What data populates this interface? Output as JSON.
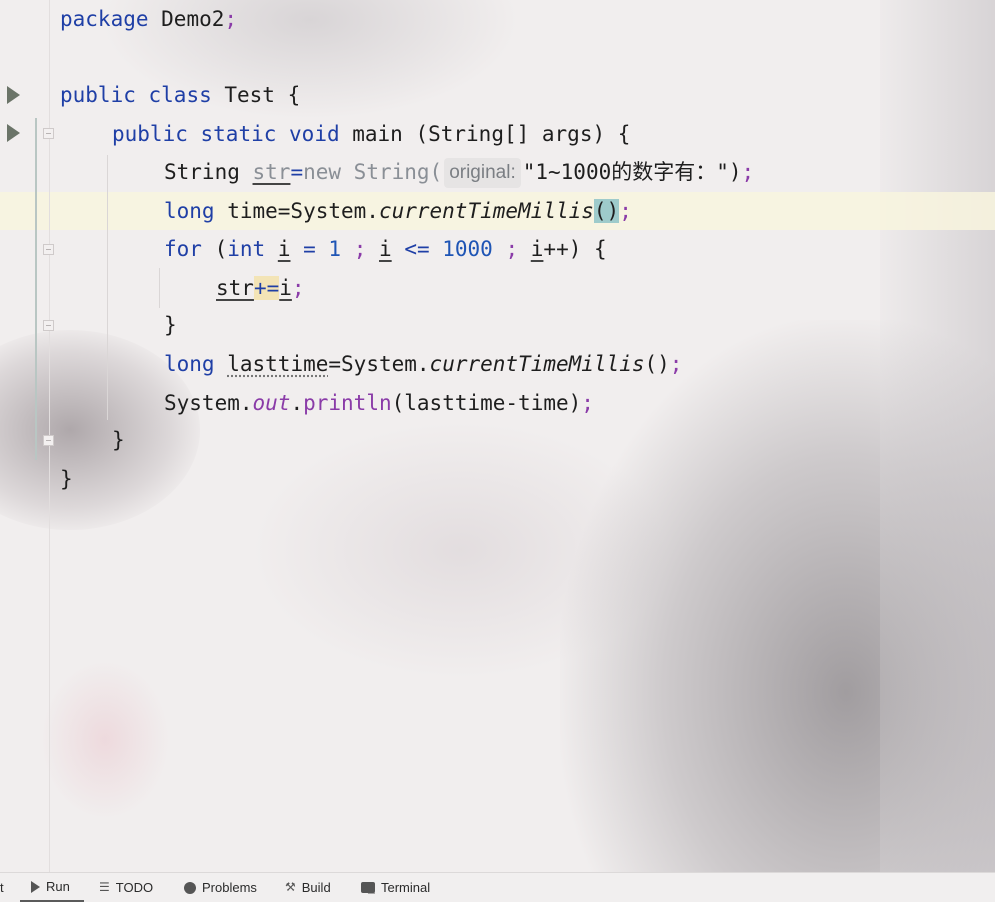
{
  "editor": {
    "lines": {
      "l1": {
        "kw": "package",
        "rest": " Demo2",
        "semi": ";"
      },
      "l3": {
        "kw1": "public",
        "kw2": "class",
        "name": " Test {"
      },
      "l4": {
        "kw1": "public",
        "kw2": "static",
        "kw3": "void",
        "name": " main (String[] args) {"
      },
      "l5": {
        "type": "String ",
        "var": "str",
        "eq": "=",
        "new": "new String(",
        "hint": "original:",
        "string": "\"1~1000的数字有：\")",
        "semi": ";"
      },
      "l6": {
        "kw": "long",
        "decl": " time=System.",
        "method": "currentTimeMillis",
        "parens": "()",
        "semi": ";"
      },
      "l7": {
        "kw1": "for",
        "p1": " (",
        "kw2": "int",
        "sp": " ",
        "i1": "i",
        "eq": " = ",
        "n1": "1",
        "s1": " ; ",
        "i2": "i",
        "le": " <= ",
        "n2": "1000",
        "s2": " ; ",
        "i3": "i",
        "pp": "++) {"
      },
      "l8": {
        "var": "str",
        "op": "+=",
        "i": "i",
        "semi": ";"
      },
      "l9": {
        "brace": "}"
      },
      "l10": {
        "kw": "long",
        "sp": " ",
        "var": "lasttime",
        "decl": "=System.",
        "method": "currentTimeMillis",
        "parens": "()",
        "semi": ";"
      },
      "l11": {
        "sys": "System.",
        "field": "out",
        "dot": ".",
        "method": "println",
        "args": "(lasttime-time)",
        "semi": ";"
      },
      "l12": {
        "brace": "}"
      },
      "l13": {
        "brace": "}"
      }
    }
  },
  "toolbar": {
    "cut_label": "t",
    "run_label": "Run",
    "todo_label": "TODO",
    "problems_label": "Problems",
    "build_label": "Build",
    "terminal_label": "Terminal"
  }
}
